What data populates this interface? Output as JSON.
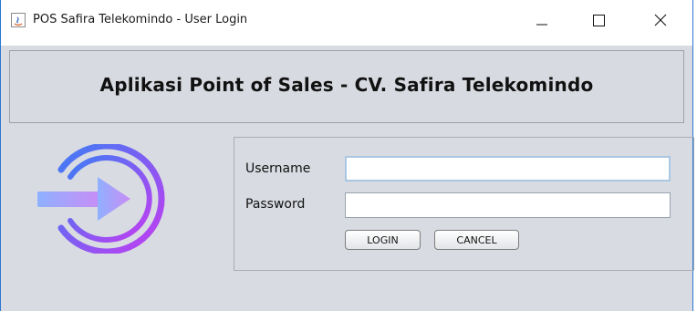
{
  "window": {
    "title": "POS Safira Telekomindo - User Login",
    "controls": [
      "minimize-icon",
      "maximize-icon",
      "close-icon"
    ]
  },
  "banner": {
    "title": "Aplikasi Point of Sales - CV. Safira Telekomindo"
  },
  "logo": {
    "icon": "login-icon"
  },
  "form": {
    "username_label": "Username",
    "username_value": "",
    "password_label": "Password",
    "password_value": "",
    "login_label": "LOGIN",
    "cancel_label": "CANCEL"
  },
  "colors": {
    "accent_blue": "#2b78d4",
    "logo_gradient_start": "#3f7df5",
    "logo_gradient_end": "#c33cf0",
    "arrow_start": "#8fb1ff",
    "arrow_end": "#c98cf5"
  }
}
